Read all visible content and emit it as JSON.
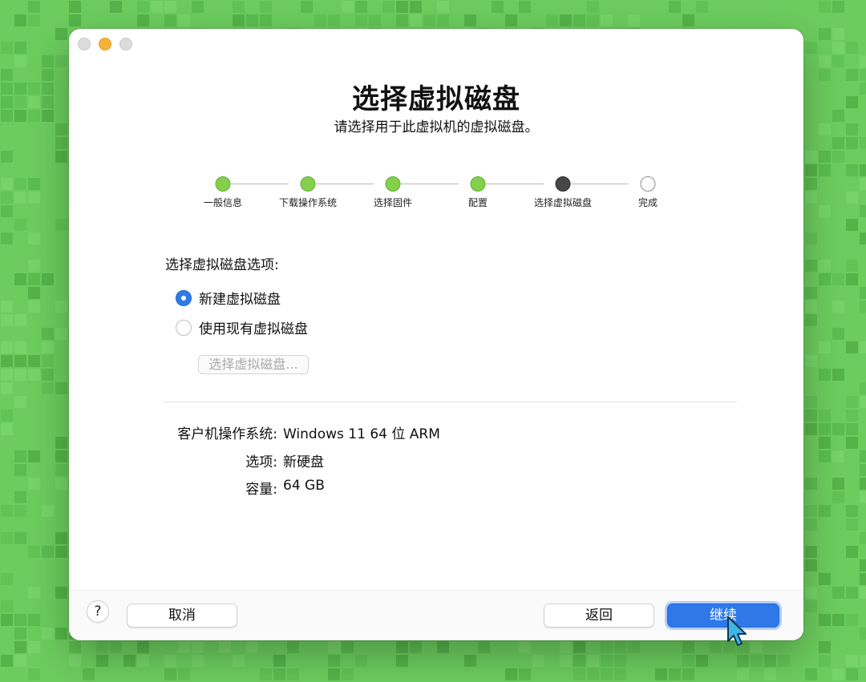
{
  "window": {
    "title": "选择虚拟磁盘",
    "subtitle": "请选择用于此虚拟机的虚拟磁盘。"
  },
  "steps": [
    {
      "label": "一般信息",
      "state": "done"
    },
    {
      "label": "下载操作系统",
      "state": "done"
    },
    {
      "label": "选择固件",
      "state": "done"
    },
    {
      "label": "配置",
      "state": "done"
    },
    {
      "label": "选择虚拟磁盘",
      "state": "current"
    },
    {
      "label": "完成",
      "state": "todo"
    }
  ],
  "options": {
    "label": "选择虚拟磁盘选项:",
    "new_disk": {
      "label": "新建虚拟磁盘",
      "selected": true
    },
    "existing_disk": {
      "label": "使用现有虚拟磁盘",
      "selected": false
    },
    "choose_button": "选择虚拟磁盘..."
  },
  "summary": [
    {
      "key": "客户机操作系统:",
      "value": "Windows 11 64 位 ARM"
    },
    {
      "key": "选项:",
      "value": "新硬盘"
    },
    {
      "key": "容量:",
      "value": "64 GB"
    }
  ],
  "footer": {
    "help": "?",
    "cancel": "取消",
    "back": "返回",
    "continue": "继续"
  },
  "colors": {
    "background": "#6ccd5e",
    "step_done": "#84cf4c",
    "step_current": "#474747",
    "accent": "#2f78e8"
  }
}
